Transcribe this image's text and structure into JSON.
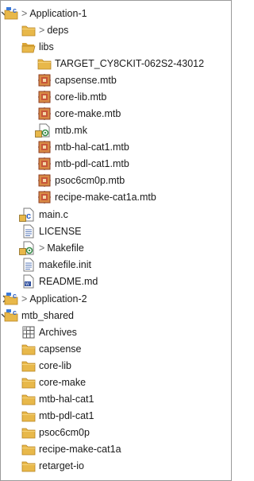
{
  "tree": [
    {
      "label": "Application-1",
      "decoration": ">",
      "icon": "project-folder-icon",
      "expanded": true
    },
    {
      "label": "deps",
      "decoration": ">",
      "icon": "folder-icon",
      "expanded": false
    },
    {
      "label": "libs",
      "icon": "folder-icon",
      "expanded": true
    },
    {
      "label": "TARGET_CY8CKIT-062S2-43012",
      "icon": "folder-icon",
      "expanded": false
    },
    {
      "label": "capsense.mtb",
      "icon": "mtb-file-icon"
    },
    {
      "label": "core-lib.mtb",
      "icon": "mtb-file-icon"
    },
    {
      "label": "core-make.mtb",
      "icon": "mtb-file-icon"
    },
    {
      "label": "mtb.mk",
      "icon": "makefile-icon"
    },
    {
      "label": "mtb-hal-cat1.mtb",
      "icon": "mtb-file-icon"
    },
    {
      "label": "mtb-pdl-cat1.mtb",
      "icon": "mtb-file-icon"
    },
    {
      "label": "psoc6cm0p.mtb",
      "icon": "mtb-file-icon"
    },
    {
      "label": "recipe-make-cat1a.mtb",
      "icon": "mtb-file-icon"
    },
    {
      "label": "main.c",
      "icon": "c-source-icon",
      "expanded": false
    },
    {
      "label": "LICENSE",
      "icon": "text-file-icon"
    },
    {
      "label": "Makefile",
      "decoration": ">",
      "icon": "makefile-icon"
    },
    {
      "label": "makefile.init",
      "icon": "text-file-icon"
    },
    {
      "label": "README.md",
      "icon": "markdown-file-icon"
    },
    {
      "label": "Application-2",
      "decoration": ">",
      "icon": "project-folder-icon",
      "expanded": false
    },
    {
      "label": "mtb_shared",
      "icon": "project-folder-icon",
      "expanded": true
    },
    {
      "label": "Archives",
      "icon": "archives-icon",
      "expanded": false
    },
    {
      "label": "capsense",
      "icon": "folder-icon",
      "expanded": false
    },
    {
      "label": "core-lib",
      "icon": "folder-icon",
      "expanded": false
    },
    {
      "label": "core-make",
      "icon": "folder-icon",
      "expanded": false
    },
    {
      "label": "mtb-hal-cat1",
      "icon": "folder-icon",
      "expanded": false
    },
    {
      "label": "mtb-pdl-cat1",
      "icon": "folder-icon",
      "expanded": false
    },
    {
      "label": "psoc6cm0p",
      "icon": "folder-icon",
      "expanded": false
    },
    {
      "label": "recipe-make-cat1a",
      "icon": "folder-icon",
      "expanded": false
    },
    {
      "label": "retarget-io",
      "icon": "folder-icon",
      "expanded": false
    }
  ],
  "colors": {
    "folder": "#e8b84a",
    "mtb_file": "#c8553a",
    "c_letter": "#2f62c6",
    "chevron": "#404040",
    "text": "#1a1a1a"
  }
}
